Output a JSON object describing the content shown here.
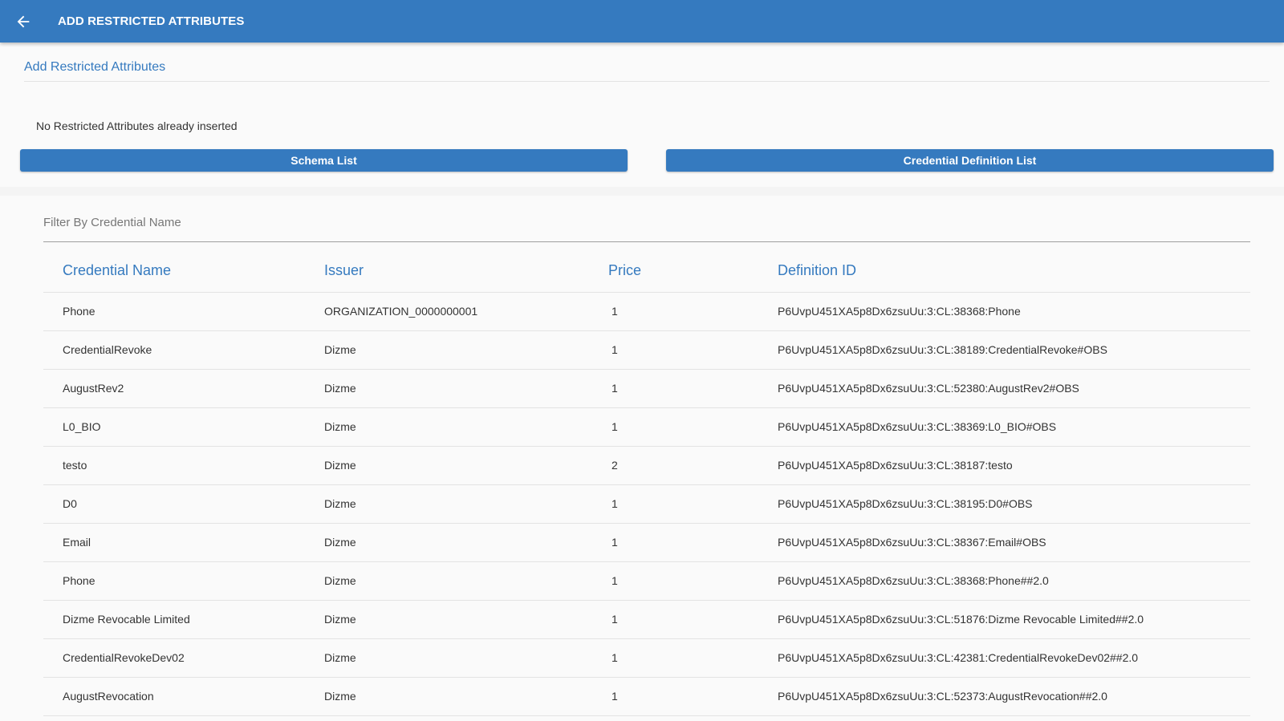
{
  "header": {
    "title": "ADD RESTRICTED ATTRIBUTES",
    "back_icon": "arrow-left-icon",
    "color": "#357abf"
  },
  "restricted": {
    "section_title": "Add Restricted Attributes",
    "empty_message": "No Restricted Attributes already inserted",
    "schema_button": "Schema List",
    "creddef_button": "Credential Definition List"
  },
  "filter": {
    "placeholder": "Filter By Credential Name",
    "value": ""
  },
  "table": {
    "columns": [
      "Credential Name",
      "Issuer",
      "Price",
      "Definition ID"
    ],
    "rows": [
      {
        "name": "Phone",
        "issuer": "ORGANIZATION_0000000001",
        "price": "1",
        "def_id": "P6UvpU451XA5p8Dx6zsuUu:3:CL:38368:Phone"
      },
      {
        "name": "CredentialRevoke",
        "issuer": "Dizme",
        "price": "1",
        "def_id": "P6UvpU451XA5p8Dx6zsuUu:3:CL:38189:CredentialRevoke#OBS"
      },
      {
        "name": "AugustRev2",
        "issuer": "Dizme",
        "price": "1",
        "def_id": "P6UvpU451XA5p8Dx6zsuUu:3:CL:52380:AugustRev2#OBS"
      },
      {
        "name": "L0_BIO",
        "issuer": "Dizme",
        "price": "1",
        "def_id": "P6UvpU451XA5p8Dx6zsuUu:3:CL:38369:L0_BIO#OBS"
      },
      {
        "name": "testo",
        "issuer": "Dizme",
        "price": "2",
        "def_id": "P6UvpU451XA5p8Dx6zsuUu:3:CL:38187:testo"
      },
      {
        "name": "D0",
        "issuer": "Dizme",
        "price": "1",
        "def_id": "P6UvpU451XA5p8Dx6zsuUu:3:CL:38195:D0#OBS"
      },
      {
        "name": "Email",
        "issuer": "Dizme",
        "price": "1",
        "def_id": "P6UvpU451XA5p8Dx6zsuUu:3:CL:38367:Email#OBS"
      },
      {
        "name": "Phone",
        "issuer": "Dizme",
        "price": "1",
        "def_id": "P6UvpU451XA5p8Dx6zsuUu:3:CL:38368:Phone##2.0"
      },
      {
        "name": "Dizme Revocable Limited",
        "issuer": "Dizme",
        "price": "1",
        "def_id": "P6UvpU451XA5p8Dx6zsuUu:3:CL:51876:Dizme Revocable Limited##2.0"
      },
      {
        "name": "CredentialRevokeDev02",
        "issuer": "Dizme",
        "price": "1",
        "def_id": "P6UvpU451XA5p8Dx6zsuUu:3:CL:42381:CredentialRevokeDev02##2.0"
      },
      {
        "name": "AugustRevocation",
        "issuer": "Dizme",
        "price": "1",
        "def_id": "P6UvpU451XA5p8Dx6zsuUu:3:CL:52373:AugustRevocation##2.0"
      }
    ]
  }
}
